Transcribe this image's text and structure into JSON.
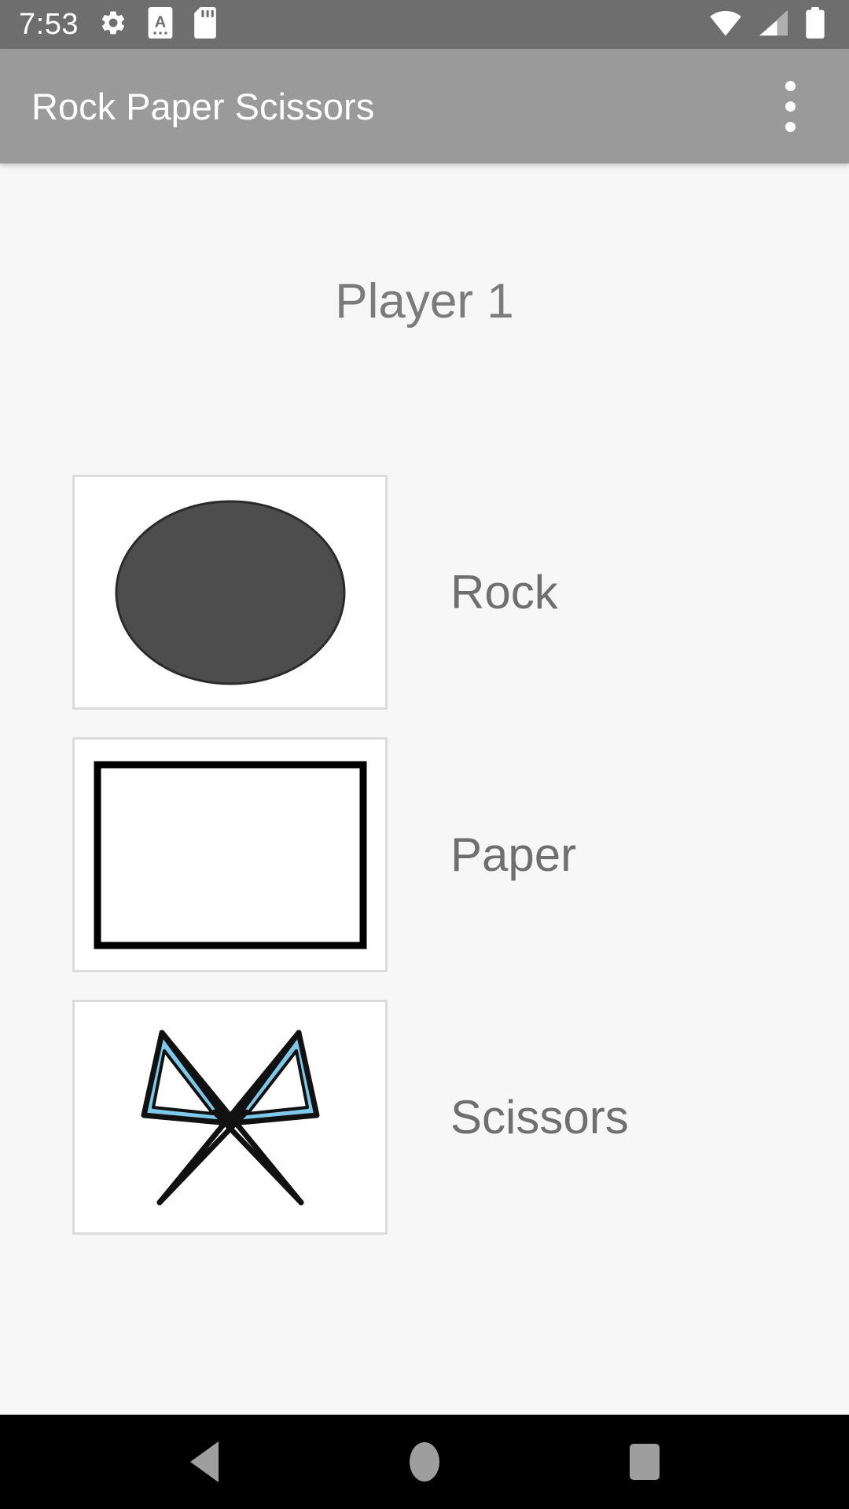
{
  "status_bar": {
    "clock": "7:53",
    "left_icons": [
      {
        "name": "settings-gear-icon",
        "glyph": "gear"
      },
      {
        "name": "screenshot-a-badge-icon",
        "glyph": "a-badge"
      },
      {
        "name": "sd-card-icon",
        "glyph": "sd-card"
      }
    ],
    "right_icons": [
      {
        "name": "wifi-icon",
        "glyph": "wifi",
        "level": "full"
      },
      {
        "name": "cellular-signal-icon",
        "glyph": "signal",
        "level": "2-of-4"
      },
      {
        "name": "battery-icon",
        "glyph": "battery",
        "level": "full"
      }
    ],
    "background_color": "#6e6e6e",
    "foreground_color": "#ffffff"
  },
  "app_bar": {
    "title": "Rock Paper Scissors",
    "overflow_menu_label": "More options",
    "background_color": "#9a9a9a",
    "title_color": "#ffffff"
  },
  "main": {
    "heading": "Player 1",
    "heading_color": "#7b7b7b",
    "background_color": "#f7f7f7",
    "choices": [
      {
        "id": "rock",
        "label": "Rock",
        "image_name": "rock-ellipse-image",
        "shape": "ellipse",
        "fill_color": "#4d4d4d",
        "stroke_color": "#2b2b2b"
      },
      {
        "id": "paper",
        "label": "Paper",
        "image_name": "paper-rectangle-image",
        "shape": "rectangle",
        "fill_color": "#ffffff",
        "stroke_color": "#000000"
      },
      {
        "id": "scissors",
        "label": "Scissors",
        "image_name": "scissors-image",
        "shape": "scissors",
        "fill_color": "#7ec9ea",
        "stroke_color": "#111111"
      }
    ],
    "label_color": "#6f6f6f",
    "card_background": "#ffffff",
    "card_border_color": "#dcdcdc"
  },
  "nav_bar": {
    "background_color": "#000000",
    "icon_color": "#9e9e9e",
    "buttons": [
      {
        "name": "nav-back-button",
        "label": "Back"
      },
      {
        "name": "nav-home-button",
        "label": "Home"
      },
      {
        "name": "nav-recents-button",
        "label": "Recents"
      }
    ]
  }
}
